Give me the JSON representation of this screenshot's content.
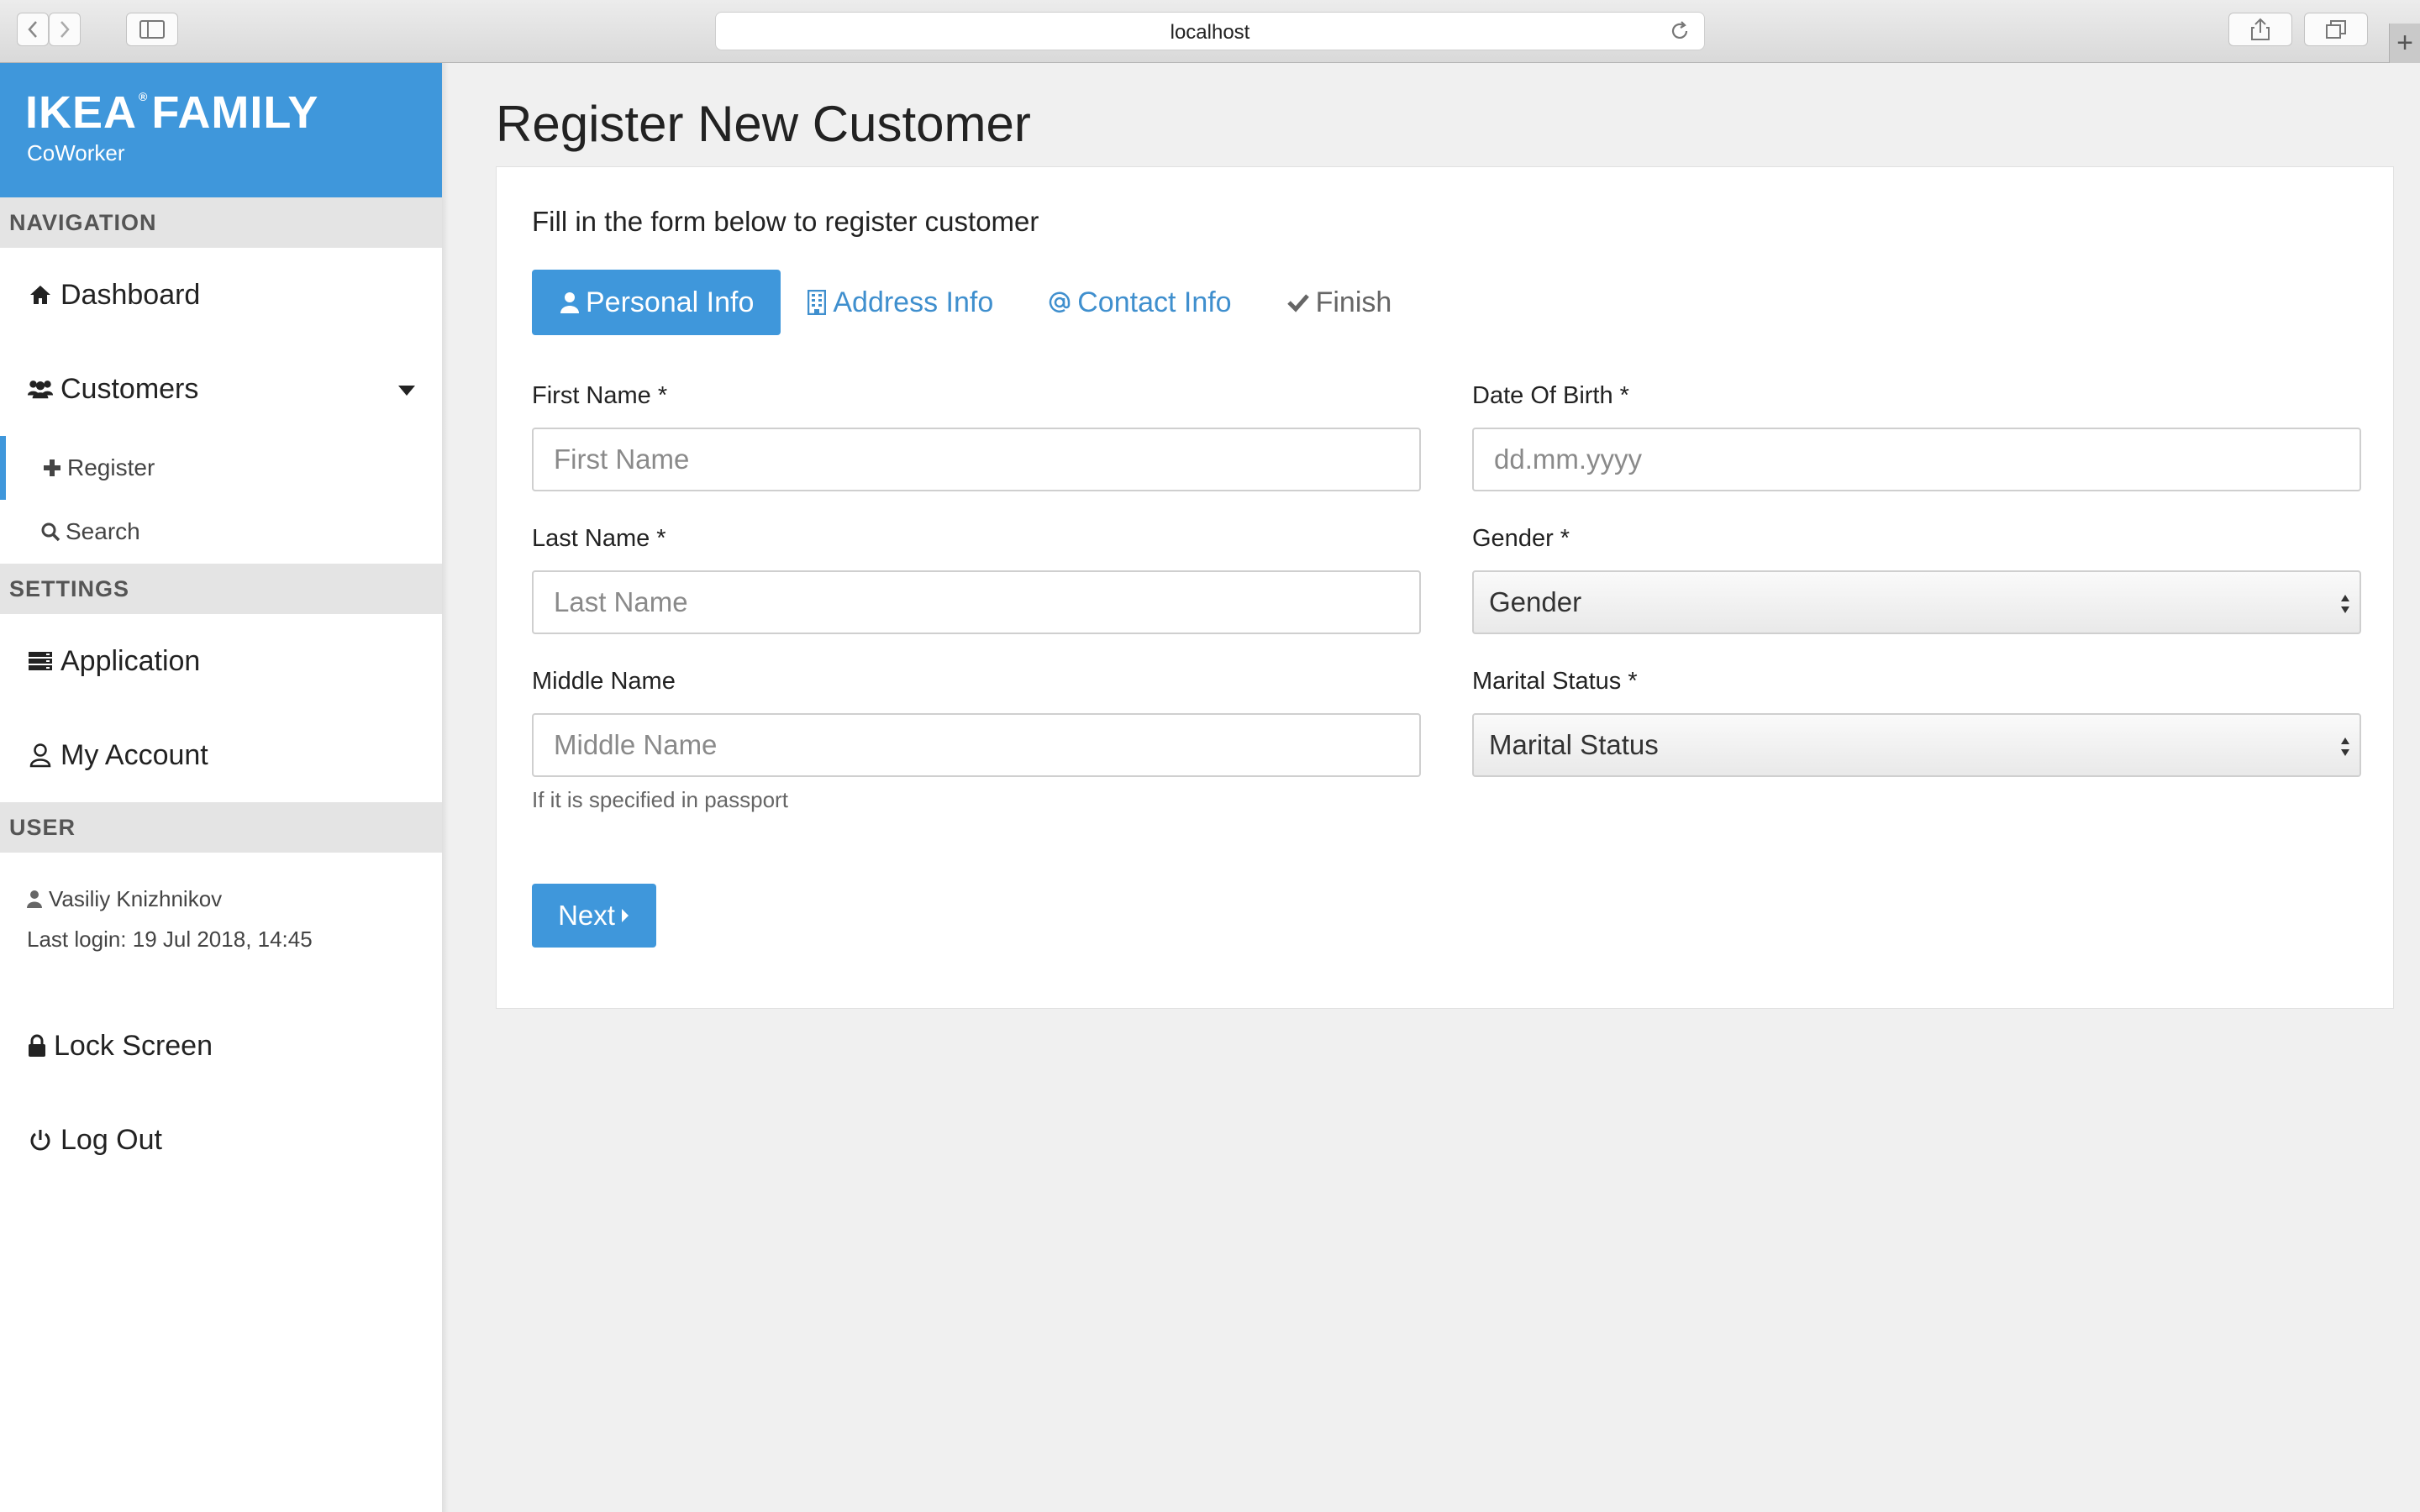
{
  "browser": {
    "url": "localhost"
  },
  "brand": {
    "name": "IKEA",
    "registered": "®",
    "name2": "FAMILY",
    "subtitle": "CoWorker"
  },
  "sidebar": {
    "nav_header": "NAVIGATION",
    "dashboard": "Dashboard",
    "customers": "Customers",
    "register": "Register",
    "search": "Search",
    "settings_header": "SETTINGS",
    "application": "Application",
    "my_account": "My Account",
    "user_header": "USER",
    "user_name": "Vasiliy Knizhnikov",
    "last_login": "Last login: 19 Jul 2018, 14:45",
    "lock_screen": "Lock Screen",
    "log_out": "Log Out"
  },
  "main": {
    "title": "Register New Customer",
    "intro": "Fill in the form below to register customer",
    "steps": [
      {
        "label": "Personal Info",
        "icon": "user-icon",
        "state": "active"
      },
      {
        "label": "Address Info",
        "icon": "building-icon",
        "state": "link"
      },
      {
        "label": "Contact Info",
        "icon": "at-icon",
        "state": "link"
      },
      {
        "label": "Finish",
        "icon": "check-icon",
        "state": "muted"
      }
    ],
    "form": {
      "first_name_label": "First Name *",
      "first_name_placeholder": "First Name",
      "first_name_value": "",
      "last_name_label": "Last Name *",
      "last_name_placeholder": "Last Name",
      "last_name_value": "",
      "middle_name_label": "Middle Name",
      "middle_name_placeholder": "Middle Name",
      "middle_name_value": "",
      "middle_name_help": "If it is specified in passport",
      "dob_label": "Date Of Birth *",
      "dob_placeholder": "dd.mm.yyyy",
      "dob_value": "",
      "gender_label": "Gender *",
      "gender_value": "Gender",
      "marital_label": "Marital Status *",
      "marital_value": "Marital Status",
      "next_label": "Next"
    }
  },
  "colors": {
    "accent": "#3f97db",
    "link": "#3f8fce",
    "background": "#f0f0f0",
    "section": "#e4e4e4"
  }
}
